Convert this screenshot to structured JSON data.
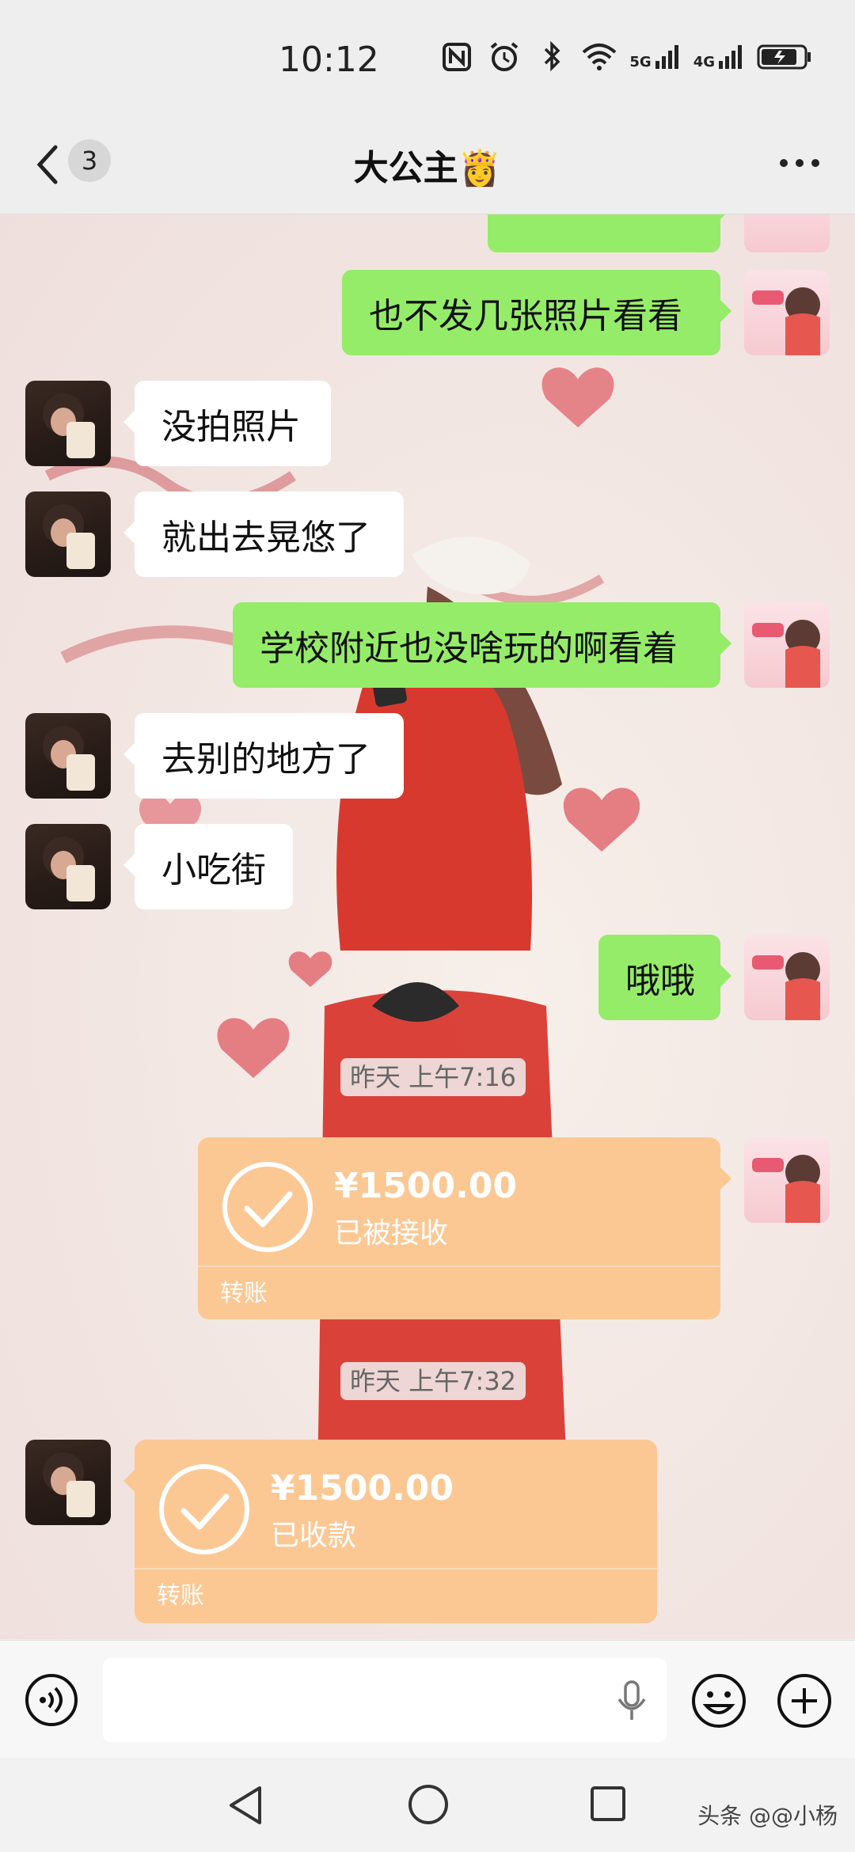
{
  "status_bar": {
    "time": "10:12",
    "network_5g": "5G",
    "network_4g": "4G",
    "icons": [
      "nfc-icon",
      "alarm-icon",
      "bluetooth-icon",
      "wifi-icon",
      "signal-5g-icon",
      "signal-4g-icon",
      "battery-icon"
    ]
  },
  "header": {
    "unread_count": "3",
    "title": "大公主👸",
    "back_icon": "chevron-left-icon",
    "more_icon": "more-dots-icon"
  },
  "messages": [
    {
      "side": "right",
      "type": "text",
      "text": "也不发几张照片看看"
    },
    {
      "side": "left",
      "type": "text",
      "text": "没拍照片"
    },
    {
      "side": "left",
      "type": "text",
      "text": "就出去晃悠了"
    },
    {
      "side": "right",
      "type": "text",
      "text": "学校附近也没啥玩的啊看着"
    },
    {
      "side": "left",
      "type": "text",
      "text": "去别的地方了"
    },
    {
      "side": "left",
      "type": "text",
      "text": "小吃街"
    },
    {
      "side": "right",
      "type": "text",
      "text": "哦哦"
    },
    {
      "type": "timestamp",
      "text": "昨天 上午7:16"
    },
    {
      "side": "right",
      "type": "transfer",
      "amount": "¥1500.00",
      "status": "已被接收",
      "label": "转账"
    },
    {
      "type": "timestamp",
      "text": "昨天 上午7:32"
    },
    {
      "side": "left",
      "type": "transfer",
      "amount": "¥1500.00",
      "status": "已收款",
      "label": "转账"
    }
  ],
  "input_bar": {
    "placeholder": "",
    "icons": [
      "voice-icon",
      "mic-icon",
      "emoji-icon",
      "plus-icon"
    ]
  },
  "system_nav": {
    "icons": [
      "nav-back-icon",
      "nav-home-icon",
      "nav-recent-icon"
    ],
    "watermark": "头条 @@小杨"
  },
  "colors": {
    "sent_bubble": "#95ec69",
    "received_bubble": "#ffffff",
    "transfer_card": "#fbc894",
    "chrome": "#eeeeee"
  }
}
